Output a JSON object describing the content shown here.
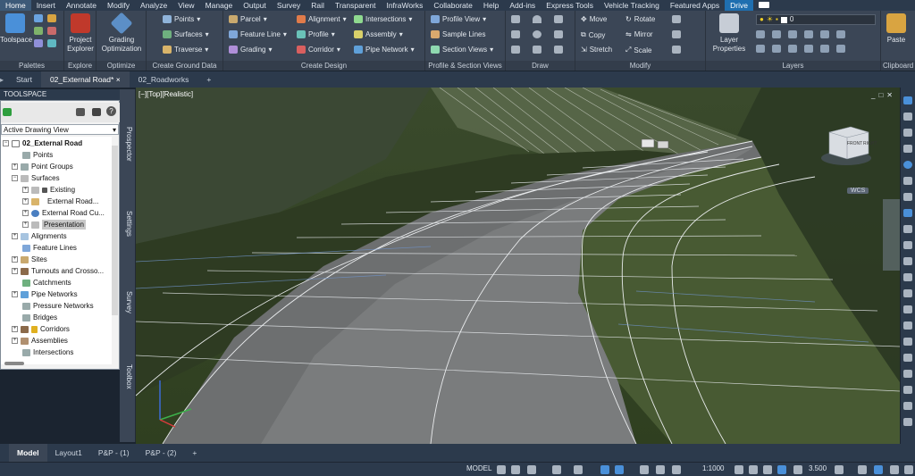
{
  "menu": [
    "Home",
    "Insert",
    "Annotate",
    "Modify",
    "Analyze",
    "View",
    "Manage",
    "Output",
    "Survey",
    "Rail",
    "Transparent",
    "InfraWorks",
    "Collaborate",
    "Help",
    "Add-ins",
    "Express Tools",
    "Vehicle Tracking",
    "Featured Apps",
    "Drive"
  ],
  "ribbon": {
    "palettes": {
      "big": "Toolspace",
      "title": "Palettes"
    },
    "explore": {
      "big": "Project Explorer",
      "title": "Explore"
    },
    "optimize": {
      "big": "Grading Optimization",
      "title": "Optimize"
    },
    "ground": {
      "items": [
        "Points",
        "Surfaces",
        "Traverse"
      ],
      "title": "Create Ground Data"
    },
    "design": {
      "items": [
        "Parcel",
        "Feature Line",
        "Grading",
        "Alignment",
        "Profile",
        "Corridor",
        "Intersections",
        "Assembly",
        "Pipe Network"
      ],
      "title": "Create Design"
    },
    "profile": {
      "items": [
        "Profile View",
        "Sample Lines",
        "Section Views"
      ],
      "title": "Profile & Section Views"
    },
    "draw": {
      "title": "Draw"
    },
    "modify": {
      "items": [
        "Move",
        "Copy",
        "Stretch",
        "Rotate",
        "Mirror",
        "Scale"
      ],
      "title": "Modify"
    },
    "layers": {
      "big": "Layer Properties",
      "title": "Layers",
      "current_layer": "0"
    },
    "clipboard": {
      "big": "Paste",
      "title": "Clipboard"
    }
  },
  "doc_tabs": [
    "Start",
    "02_External Road*",
    "02_Roadworks"
  ],
  "toolspace": {
    "title": "TOOLSPACE",
    "view_dropdown": "Active Drawing View",
    "tree": {
      "root": "02_External Road",
      "points": "Points",
      "point_groups": "Point Groups",
      "surfaces": "Surfaces",
      "existing": "Existing",
      "external_road": "External Road...",
      "external_road_cu": "External Road Cu...",
      "presentation": "Presentation",
      "alignments": "Alignments",
      "feature_lines": "Feature Lines",
      "sites": "Sites",
      "turnouts": "Turnouts and Crosso...",
      "catchments": "Catchments",
      "pipe_networks": "Pipe Networks",
      "pressure_networks": "Pressure Networks",
      "bridges": "Bridges",
      "corridors": "Corridors",
      "assemblies": "Assemblies",
      "intersections": "Intersections"
    },
    "side_tabs": [
      "Prospector",
      "Settings",
      "Survey",
      "Toolbox"
    ]
  },
  "viewport": {
    "label": "[−][Top][Realistic]",
    "wcs": "WCS",
    "cube_front": "FRONT",
    "cube_right": "RIGHT"
  },
  "layout_tabs": [
    "Model",
    "Layout1",
    "P&P - (1)",
    "P&P - (2)"
  ],
  "status": {
    "model": "MODEL",
    "scale": "1:1000",
    "value": "3.500"
  },
  "colors": {
    "accent": "#1f6fb0",
    "ribbon": "#3b4656",
    "menubar": "#2c3a4c"
  }
}
